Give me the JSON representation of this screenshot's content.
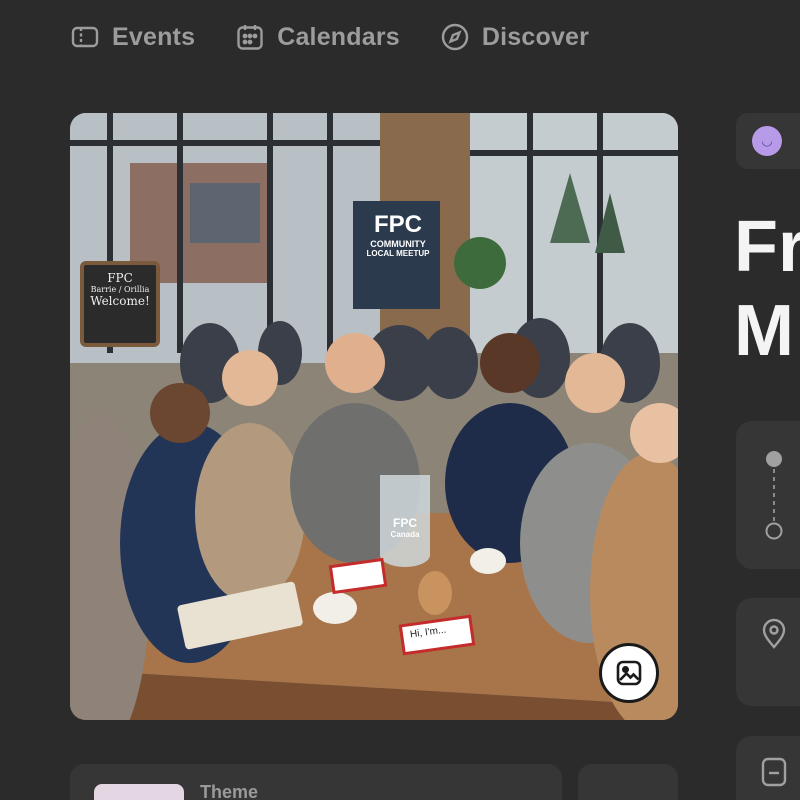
{
  "nav": {
    "events_label": "Events",
    "calendars_label": "Calendars",
    "discover_label": "Discover"
  },
  "photo": {
    "banner_line1": "FPC",
    "banner_line2": "COMMUNITY",
    "banner_line3": "LOCAL MEETUP",
    "sign_line1": "FPC",
    "sign_line2": "Barrie / Orillia",
    "sign_line3": "Welcome!",
    "pitcher_line1": "FPC",
    "pitcher_line2": "Canada",
    "nametag_text": "Hi, I'm...",
    "change_image_icon": "image-icon"
  },
  "event": {
    "title_line1": "Fr",
    "title_line2": "M"
  },
  "theme": {
    "label": "Theme"
  },
  "colors": {
    "background": "#2b2b2b",
    "card": "#363636",
    "title": "#f4f4f4",
    "nav_text": "#9c9c9c",
    "avatar": "#b79ae8"
  }
}
